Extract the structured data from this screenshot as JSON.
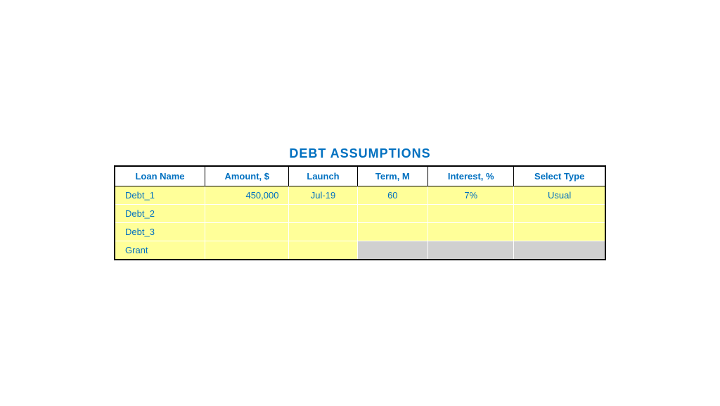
{
  "title": "DEBT ASSUMPTIONS",
  "table": {
    "headers": [
      "Loan Name",
      "Amount, $",
      "Launch",
      "Term, M",
      "Interest, %",
      "Select Type"
    ],
    "rows": [
      {
        "loan_name": "Debt_1",
        "amount": "450,000",
        "launch": "Jul-19",
        "term": "60",
        "interest": "7%",
        "select_type": "Usual",
        "gray_cells": false
      },
      {
        "loan_name": "Debt_2",
        "amount": "",
        "launch": "",
        "term": "",
        "interest": "",
        "select_type": "",
        "gray_cells": false
      },
      {
        "loan_name": "Debt_3",
        "amount": "",
        "launch": "",
        "term": "",
        "interest": "",
        "select_type": "",
        "gray_cells": false
      },
      {
        "loan_name": "Grant",
        "amount": "",
        "launch": "",
        "term": "",
        "interest": "",
        "select_type": "",
        "gray_cells": true
      }
    ]
  }
}
